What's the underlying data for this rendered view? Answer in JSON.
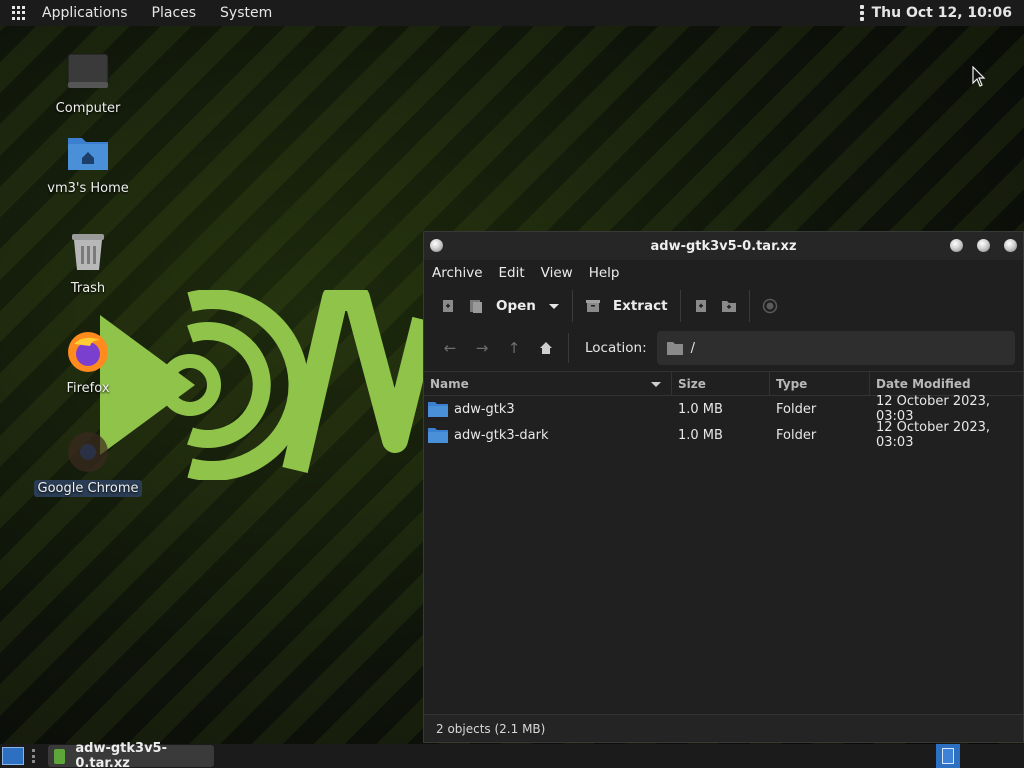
{
  "top_panel": {
    "menus": [
      "Applications",
      "Places",
      "System"
    ],
    "clock": "Thu Oct 12, 10:06"
  },
  "desktop": {
    "icons": [
      {
        "label": "Computer",
        "icon": "computer-icon"
      },
      {
        "label": "vm3's Home",
        "icon": "home-folder-icon"
      },
      {
        "label": "Trash",
        "icon": "trash-icon"
      },
      {
        "label": "Firefox",
        "icon": "firefox-icon"
      },
      {
        "label": "Google Chrome",
        "icon": "chrome-icon",
        "selected": true
      }
    ]
  },
  "window": {
    "title": "adw-gtk3v5-0.tar.xz",
    "menu": [
      "Archive",
      "Edit",
      "View",
      "Help"
    ],
    "toolbar": {
      "open_label": "Open",
      "extract_label": "Extract"
    },
    "location": {
      "label": "Location:",
      "path": "/"
    },
    "columns": [
      "Name",
      "Size",
      "Type",
      "Date Modified"
    ],
    "rows": [
      {
        "name": "adw-gtk3",
        "size": "1.0 MB",
        "type": "Folder",
        "date": "12 October 2023, 03:03"
      },
      {
        "name": "adw-gtk3-dark",
        "size": "1.0 MB",
        "type": "Folder",
        "date": "12 October 2023, 03:03"
      }
    ],
    "status": "2 objects (2.1 MB)"
  },
  "taskbar": {
    "tasks": [
      {
        "label": "adw-gtk3v5-0.tar.xz"
      }
    ]
  },
  "colors": {
    "accent": "#2d6fc0",
    "logo_green": "#8fc34a",
    "folder_blue": "#4a90d9"
  }
}
